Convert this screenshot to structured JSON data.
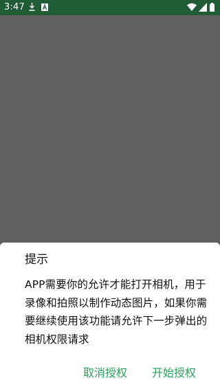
{
  "status_bar": {
    "time": "3:47",
    "icons": [
      "download-icon",
      "notification-a-icon",
      "wifi-icon",
      "signal-icon",
      "battery-icon"
    ]
  },
  "dialog": {
    "title": "提示",
    "message": "APP需要你的允许才能打开相机，用于录像和拍照以制作动态图片，如果你需要继续使用该功能请允许下一步弹出的相机权限请求",
    "cancel_label": "取消授权",
    "confirm_label": "开始授权"
  },
  "colors": {
    "status_bar": "#1f5b35",
    "scrim": "#5f5f5f",
    "accent": "#26a35a"
  }
}
